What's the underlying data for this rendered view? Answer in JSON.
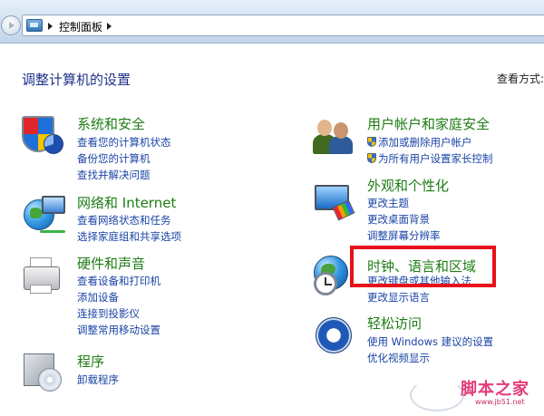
{
  "address_bar": {
    "path": "控制面板"
  },
  "header": {
    "title": "调整计算机的设置",
    "view_by": "查看方式:"
  },
  "categories": {
    "system": {
      "title": "系统和安全",
      "links": [
        "查看您的计算机状态",
        "备份您的计算机",
        "查找并解决问题"
      ]
    },
    "network": {
      "title": "网络和 Internet",
      "links": [
        "查看网络状态和任务",
        "选择家庭组和共享选项"
      ]
    },
    "hardware": {
      "title": "硬件和声音",
      "links": [
        "查看设备和打印机",
        "添加设备",
        "连接到投影仪",
        "调整常用移动设置"
      ]
    },
    "programs": {
      "title": "程序",
      "links": [
        "卸载程序"
      ]
    },
    "users": {
      "title": "用户帐户和家庭安全",
      "links": [
        "添加或删除用户帐户",
        "为所有用户设置家长控制"
      ]
    },
    "appearance": {
      "title": "外观和个性化",
      "links": [
        "更改主题",
        "更改桌面背景",
        "调整屏幕分辨率"
      ]
    },
    "clock": {
      "title": "时钟、语言和区域",
      "links": [
        "更改键盘或其他输入法",
        "更改显示语言"
      ]
    },
    "ease": {
      "title": "轻松访问",
      "links": [
        "使用 Windows 建议的设置",
        "优化视频显示"
      ]
    }
  },
  "watermark": {
    "brand": "脚本之家",
    "url": "www.jb51.net"
  },
  "colors": {
    "title_green": "#1e7d15",
    "link_blue": "#1a44a6",
    "heading_blue": "#1e3287",
    "highlight_red": "#e8101a"
  }
}
